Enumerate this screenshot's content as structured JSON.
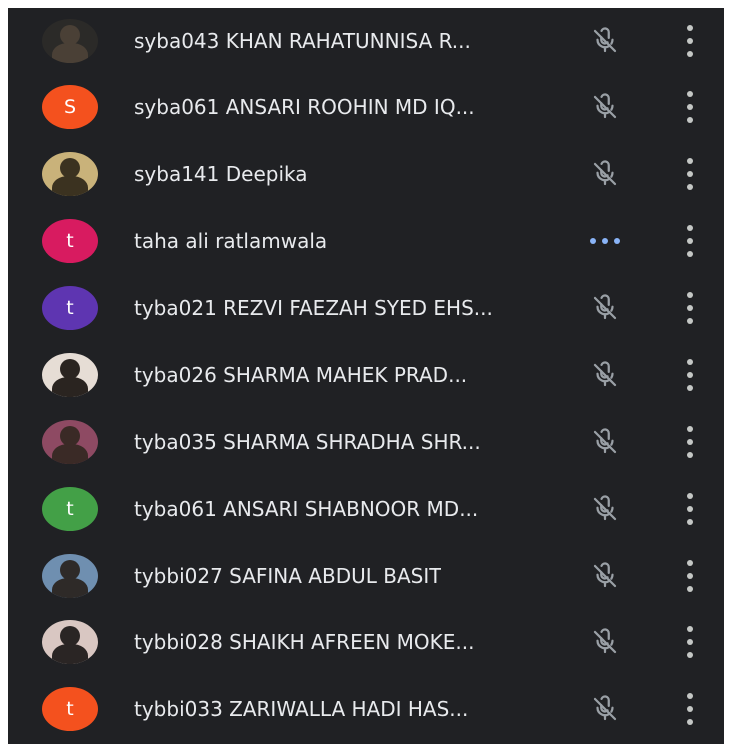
{
  "participants": [
    {
      "name": "syba043 KHAN RAHATUNNISA R...",
      "avatar": {
        "type": "photo",
        "letter": "",
        "colors": [
          "#4a4036",
          "#2b2a28"
        ]
      },
      "mic_icon": "mic-off-icon",
      "more_icon": "more-vert-icon"
    },
    {
      "name": "syba061 ANSARI ROOHIN MD IQ...",
      "avatar": {
        "type": "letter",
        "letter": "S",
        "bg": "#f4511e"
      },
      "mic_icon": "mic-off-icon",
      "more_icon": "more-vert-icon"
    },
    {
      "name": "syba141 Deepika",
      "avatar": {
        "type": "photo",
        "letter": "",
        "colors": [
          "#3b3220",
          "#c9b27a"
        ]
      },
      "mic_icon": "mic-off-icon",
      "more_icon": "more-vert-icon"
    },
    {
      "name": "taha ali ratlamwala",
      "avatar": {
        "type": "letter",
        "letter": "t",
        "bg": "#d81b60"
      },
      "mic_icon": "speaking-dots-icon",
      "more_icon": "more-vert-icon"
    },
    {
      "name": "tyba021 REZVI FAEZAH SYED EHS...",
      "avatar": {
        "type": "letter",
        "letter": "t",
        "bg": "#5e35b1"
      },
      "mic_icon": "mic-off-icon",
      "more_icon": "more-vert-icon"
    },
    {
      "name": "tyba026 SHARMA MAHEK PRAD...",
      "avatar": {
        "type": "photo",
        "letter": "",
        "colors": [
          "#2a2420",
          "#e6ddd5"
        ]
      },
      "mic_icon": "mic-off-icon",
      "more_icon": "more-vert-icon"
    },
    {
      "name": "tyba035 SHARMA SHRADHA SHR...",
      "avatar": {
        "type": "photo",
        "letter": "",
        "colors": [
          "#3a2a26",
          "#8e4a63"
        ]
      },
      "mic_icon": "mic-off-icon",
      "more_icon": "more-vert-icon"
    },
    {
      "name": "tyba061 ANSARI SHABNOOR MD...",
      "avatar": {
        "type": "letter",
        "letter": "t",
        "bg": "#43a047"
      },
      "mic_icon": "mic-off-icon",
      "more_icon": "more-vert-icon"
    },
    {
      "name": "tybbi027 SAFINA ABDUL BASIT",
      "avatar": {
        "type": "photo",
        "letter": "",
        "colors": [
          "#2e2a28",
          "#6f8fb0"
        ]
      },
      "mic_icon": "mic-off-icon",
      "more_icon": "more-vert-icon"
    },
    {
      "name": "tybbi028 SHAIKH AFREEN MOKE...",
      "avatar": {
        "type": "photo",
        "letter": "",
        "colors": [
          "#2a2524",
          "#d9c7c2"
        ]
      },
      "mic_icon": "mic-off-icon",
      "more_icon": "more-vert-icon"
    },
    {
      "name": "tybbi033 ZARIWALLA HADI HAS...",
      "avatar": {
        "type": "letter",
        "letter": "t",
        "bg": "#f4511e"
      },
      "mic_icon": "mic-off-icon",
      "more_icon": "more-vert-icon"
    }
  ]
}
